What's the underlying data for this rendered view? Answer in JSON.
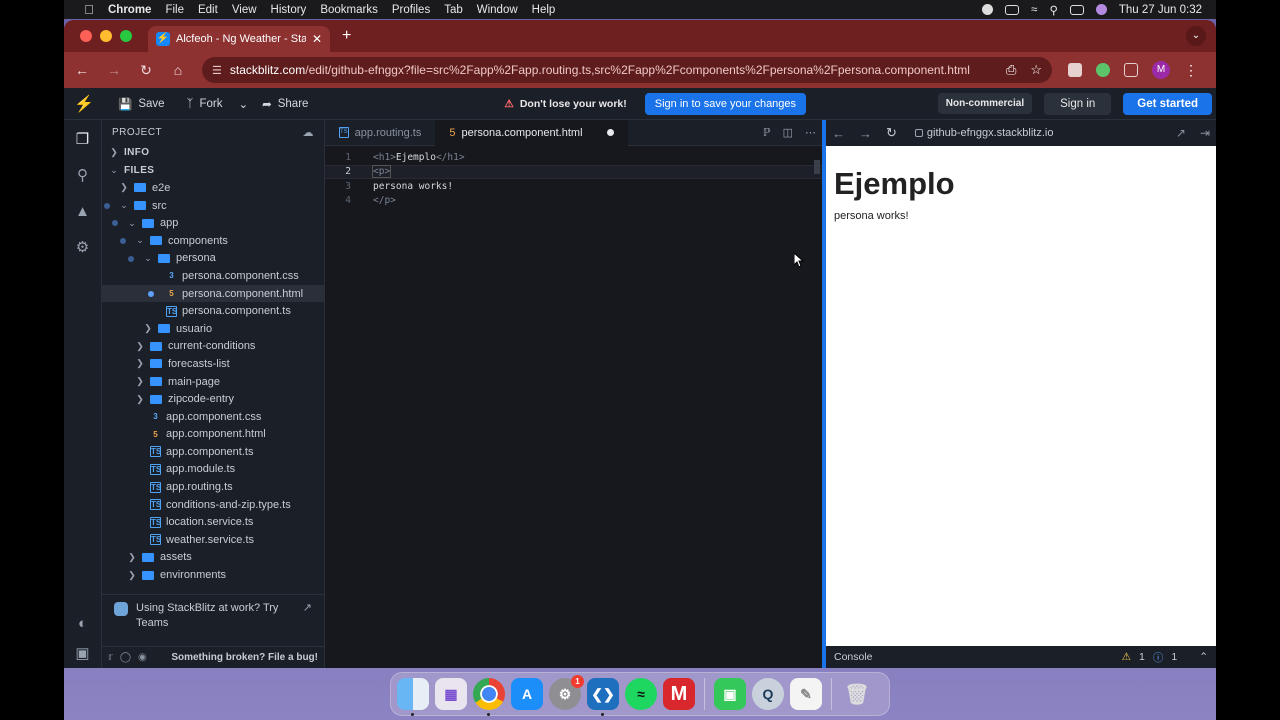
{
  "menubar": {
    "app": "Chrome",
    "items": [
      "File",
      "Edit",
      "View",
      "History",
      "Bookmarks",
      "Profiles",
      "Tab",
      "Window",
      "Help"
    ],
    "datetime": "Thu 27 Jun  0:32"
  },
  "browser": {
    "tab_title": "Alcfeoh - Ng Weather - Stack",
    "url_host": "stackblitz.com",
    "url_rest": "/edit/github-efnggx?file=src%2Fapp%2Fapp.routing.ts,src%2Fapp%2Fcomponents%2Fpersona%2Fpersona.component.html",
    "avatar": "M"
  },
  "stackblitz": {
    "save": "Save",
    "fork": "Fork",
    "share": "Share",
    "warning": "Don't lose your work!",
    "signin_save": "Sign in to save your changes",
    "noncommercial": "Non-commercial",
    "signin": "Sign in",
    "get_started": "Get started"
  },
  "sidebar": {
    "project_label": "PROJECT",
    "info_label": "INFO",
    "files_label": "FILES",
    "tree": [
      {
        "label": "e2e",
        "kind": "folder",
        "depth": 1,
        "expanded": false
      },
      {
        "label": "src",
        "kind": "folder",
        "depth": 1,
        "expanded": true
      },
      {
        "label": "app",
        "kind": "folder",
        "depth": 2,
        "expanded": true
      },
      {
        "label": "components",
        "kind": "folder",
        "depth": 3,
        "expanded": true
      },
      {
        "label": "persona",
        "kind": "folder",
        "depth": 4,
        "expanded": true
      },
      {
        "label": "persona.component.css",
        "kind": "css",
        "depth": 5
      },
      {
        "label": "persona.component.html",
        "kind": "html",
        "depth": 5,
        "selected": true
      },
      {
        "label": "persona.component.ts",
        "kind": "ts",
        "depth": 5
      },
      {
        "label": "usuario",
        "kind": "folder",
        "depth": 4,
        "expanded": false
      },
      {
        "label": "current-conditions",
        "kind": "folder",
        "depth": 3,
        "expanded": false
      },
      {
        "label": "forecasts-list",
        "kind": "folder",
        "depth": 3,
        "expanded": false
      },
      {
        "label": "main-page",
        "kind": "folder",
        "depth": 3,
        "expanded": false
      },
      {
        "label": "zipcode-entry",
        "kind": "folder",
        "depth": 3,
        "expanded": false
      },
      {
        "label": "app.component.css",
        "kind": "css",
        "depth": 3
      },
      {
        "label": "app.component.html",
        "kind": "html",
        "depth": 3
      },
      {
        "label": "app.component.ts",
        "kind": "ts",
        "depth": 3
      },
      {
        "label": "app.module.ts",
        "kind": "ts",
        "depth": 3
      },
      {
        "label": "app.routing.ts",
        "kind": "ts",
        "depth": 3
      },
      {
        "label": "conditions-and-zip.type.ts",
        "kind": "ts",
        "depth": 3
      },
      {
        "label": "location.service.ts",
        "kind": "ts",
        "depth": 3
      },
      {
        "label": "weather.service.ts",
        "kind": "ts",
        "depth": 3
      },
      {
        "label": "assets",
        "kind": "folder",
        "depth": 2,
        "expanded": false
      },
      {
        "label": "environments",
        "kind": "folder",
        "depth": 2,
        "expanded": false
      }
    ],
    "promo": "Using StackBlitz at work? Try Teams",
    "footer": "Something broken? File a bug!"
  },
  "editor": {
    "tabs": [
      {
        "label": "app.routing.ts",
        "active": false
      },
      {
        "label": "persona.component.html",
        "active": true,
        "unsaved": true
      }
    ],
    "lines": [
      {
        "num": "1",
        "open": "<h1>",
        "text": "Ejemplo",
        "close": "</h1>"
      },
      {
        "num": "2",
        "open": "<p>",
        "text": "",
        "close": ""
      },
      {
        "num": "3",
        "open": "",
        "text": "persona works!",
        "close": ""
      },
      {
        "num": "4",
        "open": "",
        "text": "",
        "close": "</p>"
      }
    ]
  },
  "preview": {
    "url": "github-efnggx.stackblitz.io",
    "heading": "Ejemplo",
    "paragraph": "persona works!",
    "console_label": "Console",
    "warnings": "1",
    "infos": "1"
  },
  "dock": {
    "apps": [
      "finder",
      "launchpad",
      "chrome",
      "app-store",
      "system-settings",
      "vscode",
      "spotify",
      "mega",
      "facetime",
      "quicktime",
      "textedit",
      "trash"
    ],
    "settings_badge": "1"
  }
}
